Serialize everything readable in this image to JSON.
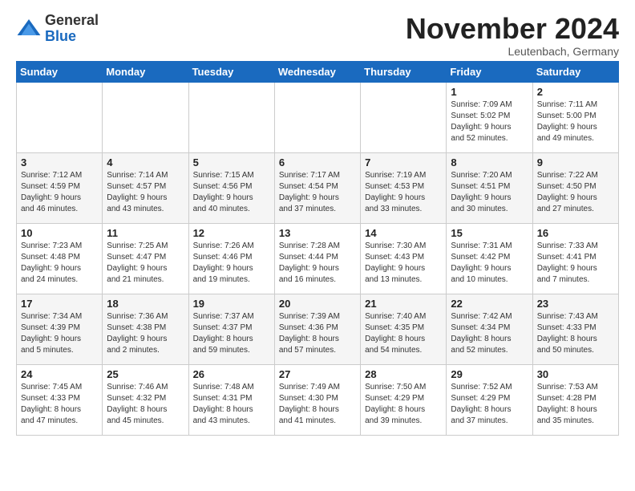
{
  "logo": {
    "general": "General",
    "blue": "Blue"
  },
  "header": {
    "month": "November 2024",
    "location": "Leutenbach, Germany"
  },
  "days_of_week": [
    "Sunday",
    "Monday",
    "Tuesday",
    "Wednesday",
    "Thursday",
    "Friday",
    "Saturday"
  ],
  "weeks": [
    [
      {
        "day": "",
        "info": ""
      },
      {
        "day": "",
        "info": ""
      },
      {
        "day": "",
        "info": ""
      },
      {
        "day": "",
        "info": ""
      },
      {
        "day": "",
        "info": ""
      },
      {
        "day": "1",
        "info": "Sunrise: 7:09 AM\nSunset: 5:02 PM\nDaylight: 9 hours\nand 52 minutes."
      },
      {
        "day": "2",
        "info": "Sunrise: 7:11 AM\nSunset: 5:00 PM\nDaylight: 9 hours\nand 49 minutes."
      }
    ],
    [
      {
        "day": "3",
        "info": "Sunrise: 7:12 AM\nSunset: 4:59 PM\nDaylight: 9 hours\nand 46 minutes."
      },
      {
        "day": "4",
        "info": "Sunrise: 7:14 AM\nSunset: 4:57 PM\nDaylight: 9 hours\nand 43 minutes."
      },
      {
        "day": "5",
        "info": "Sunrise: 7:15 AM\nSunset: 4:56 PM\nDaylight: 9 hours\nand 40 minutes."
      },
      {
        "day": "6",
        "info": "Sunrise: 7:17 AM\nSunset: 4:54 PM\nDaylight: 9 hours\nand 37 minutes."
      },
      {
        "day": "7",
        "info": "Sunrise: 7:19 AM\nSunset: 4:53 PM\nDaylight: 9 hours\nand 33 minutes."
      },
      {
        "day": "8",
        "info": "Sunrise: 7:20 AM\nSunset: 4:51 PM\nDaylight: 9 hours\nand 30 minutes."
      },
      {
        "day": "9",
        "info": "Sunrise: 7:22 AM\nSunset: 4:50 PM\nDaylight: 9 hours\nand 27 minutes."
      }
    ],
    [
      {
        "day": "10",
        "info": "Sunrise: 7:23 AM\nSunset: 4:48 PM\nDaylight: 9 hours\nand 24 minutes."
      },
      {
        "day": "11",
        "info": "Sunrise: 7:25 AM\nSunset: 4:47 PM\nDaylight: 9 hours\nand 21 minutes."
      },
      {
        "day": "12",
        "info": "Sunrise: 7:26 AM\nSunset: 4:46 PM\nDaylight: 9 hours\nand 19 minutes."
      },
      {
        "day": "13",
        "info": "Sunrise: 7:28 AM\nSunset: 4:44 PM\nDaylight: 9 hours\nand 16 minutes."
      },
      {
        "day": "14",
        "info": "Sunrise: 7:30 AM\nSunset: 4:43 PM\nDaylight: 9 hours\nand 13 minutes."
      },
      {
        "day": "15",
        "info": "Sunrise: 7:31 AM\nSunset: 4:42 PM\nDaylight: 9 hours\nand 10 minutes."
      },
      {
        "day": "16",
        "info": "Sunrise: 7:33 AM\nSunset: 4:41 PM\nDaylight: 9 hours\nand 7 minutes."
      }
    ],
    [
      {
        "day": "17",
        "info": "Sunrise: 7:34 AM\nSunset: 4:39 PM\nDaylight: 9 hours\nand 5 minutes."
      },
      {
        "day": "18",
        "info": "Sunrise: 7:36 AM\nSunset: 4:38 PM\nDaylight: 9 hours\nand 2 minutes."
      },
      {
        "day": "19",
        "info": "Sunrise: 7:37 AM\nSunset: 4:37 PM\nDaylight: 8 hours\nand 59 minutes."
      },
      {
        "day": "20",
        "info": "Sunrise: 7:39 AM\nSunset: 4:36 PM\nDaylight: 8 hours\nand 57 minutes."
      },
      {
        "day": "21",
        "info": "Sunrise: 7:40 AM\nSunset: 4:35 PM\nDaylight: 8 hours\nand 54 minutes."
      },
      {
        "day": "22",
        "info": "Sunrise: 7:42 AM\nSunset: 4:34 PM\nDaylight: 8 hours\nand 52 minutes."
      },
      {
        "day": "23",
        "info": "Sunrise: 7:43 AM\nSunset: 4:33 PM\nDaylight: 8 hours\nand 50 minutes."
      }
    ],
    [
      {
        "day": "24",
        "info": "Sunrise: 7:45 AM\nSunset: 4:33 PM\nDaylight: 8 hours\nand 47 minutes."
      },
      {
        "day": "25",
        "info": "Sunrise: 7:46 AM\nSunset: 4:32 PM\nDaylight: 8 hours\nand 45 minutes."
      },
      {
        "day": "26",
        "info": "Sunrise: 7:48 AM\nSunset: 4:31 PM\nDaylight: 8 hours\nand 43 minutes."
      },
      {
        "day": "27",
        "info": "Sunrise: 7:49 AM\nSunset: 4:30 PM\nDaylight: 8 hours\nand 41 minutes."
      },
      {
        "day": "28",
        "info": "Sunrise: 7:50 AM\nSunset: 4:29 PM\nDaylight: 8 hours\nand 39 minutes."
      },
      {
        "day": "29",
        "info": "Sunrise: 7:52 AM\nSunset: 4:29 PM\nDaylight: 8 hours\nand 37 minutes."
      },
      {
        "day": "30",
        "info": "Sunrise: 7:53 AM\nSunset: 4:28 PM\nDaylight: 8 hours\nand 35 minutes."
      }
    ]
  ]
}
